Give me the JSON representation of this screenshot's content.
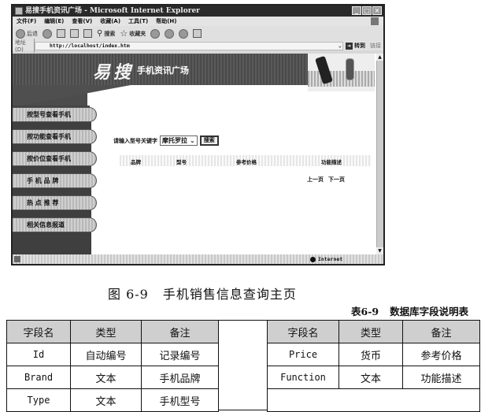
{
  "browser": {
    "window_title": "易搜手机资讯广场 - Microsoft Internet Explorer",
    "window_buttons": [
      "_",
      "□",
      "×"
    ],
    "menu": [
      "文件(F)",
      "编辑(E)",
      "查看(V)",
      "收藏(A)",
      "工具(T)",
      "帮助(H)"
    ],
    "toolbar": {
      "back_label": "后退",
      "search_label": "搜索",
      "favorites_label": "收藏夹"
    },
    "address": {
      "label": "地址(D)",
      "value": "http://localhost/index.htm",
      "go_label": "转到",
      "links_label": "链接"
    },
    "status": {
      "zone": "Internet"
    }
  },
  "page": {
    "logo": "易搜",
    "slogan": "手机资讯广场",
    "nav": [
      {
        "label": "按型号查看手机"
      },
      {
        "label": "按功能查看手机"
      },
      {
        "label": "按价位查看手机"
      },
      {
        "label": "手 机 品 牌"
      },
      {
        "label": "热 点 推 荐"
      },
      {
        "label": "相关信息报道"
      }
    ],
    "search": {
      "prompt": "请输入型号关键字",
      "selected": "摩托罗拉",
      "button": "搜索"
    },
    "results_columns": [
      "品牌",
      "型号",
      "参考价格",
      "功能描述"
    ],
    "pager": {
      "prev": "上一页",
      "next": "下一页"
    }
  },
  "figure_caption": {
    "number": "图 6-9",
    "text": "手机销售信息查询主页"
  },
  "table_caption": {
    "number": "表6-9",
    "text": "数据库字段说明表"
  },
  "fields_table": {
    "headers": [
      "字段名",
      "类型",
      "备注"
    ],
    "left_rows": [
      [
        "Id",
        "自动编号",
        "记录编号"
      ],
      [
        "Brand",
        "文本",
        "手机品牌"
      ],
      [
        "Type",
        "文本",
        "手机型号"
      ]
    ],
    "right_rows": [
      [
        "Price",
        "货币",
        "参考价格"
      ],
      [
        "Function",
        "文本",
        "功能描述"
      ]
    ]
  }
}
